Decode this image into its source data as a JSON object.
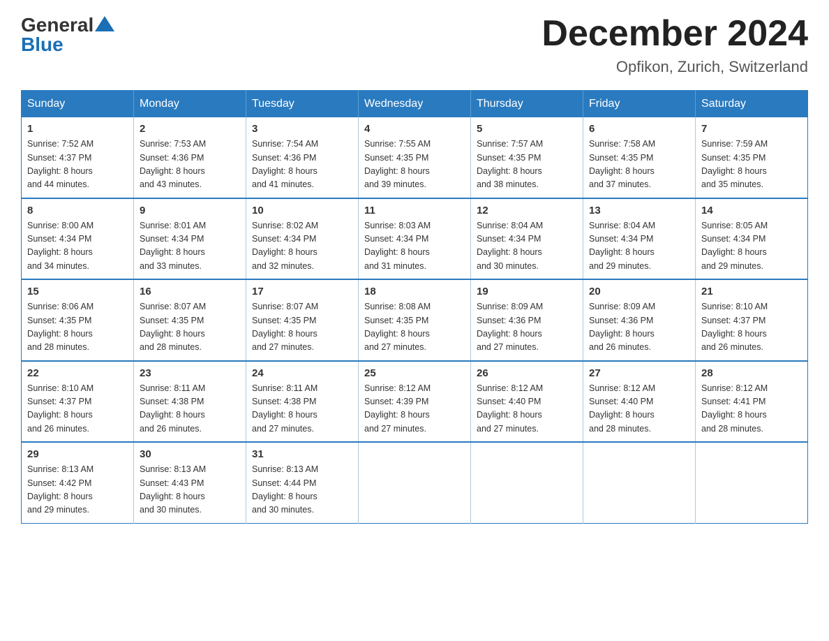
{
  "header": {
    "logo_general": "General",
    "logo_blue": "Blue",
    "main_title": "December 2024",
    "subtitle": "Opfikon, Zurich, Switzerland"
  },
  "calendar": {
    "days_of_week": [
      "Sunday",
      "Monday",
      "Tuesday",
      "Wednesday",
      "Thursday",
      "Friday",
      "Saturday"
    ],
    "weeks": [
      [
        {
          "day": "1",
          "sunrise": "7:52 AM",
          "sunset": "4:37 PM",
          "daylight": "8 hours and 44 minutes."
        },
        {
          "day": "2",
          "sunrise": "7:53 AM",
          "sunset": "4:36 PM",
          "daylight": "8 hours and 43 minutes."
        },
        {
          "day": "3",
          "sunrise": "7:54 AM",
          "sunset": "4:36 PM",
          "daylight": "8 hours and 41 minutes."
        },
        {
          "day": "4",
          "sunrise": "7:55 AM",
          "sunset": "4:35 PM",
          "daylight": "8 hours and 39 minutes."
        },
        {
          "day": "5",
          "sunrise": "7:57 AM",
          "sunset": "4:35 PM",
          "daylight": "8 hours and 38 minutes."
        },
        {
          "day": "6",
          "sunrise": "7:58 AM",
          "sunset": "4:35 PM",
          "daylight": "8 hours and 37 minutes."
        },
        {
          "day": "7",
          "sunrise": "7:59 AM",
          "sunset": "4:35 PM",
          "daylight": "8 hours and 35 minutes."
        }
      ],
      [
        {
          "day": "8",
          "sunrise": "8:00 AM",
          "sunset": "4:34 PM",
          "daylight": "8 hours and 34 minutes."
        },
        {
          "day": "9",
          "sunrise": "8:01 AM",
          "sunset": "4:34 PM",
          "daylight": "8 hours and 33 minutes."
        },
        {
          "day": "10",
          "sunrise": "8:02 AM",
          "sunset": "4:34 PM",
          "daylight": "8 hours and 32 minutes."
        },
        {
          "day": "11",
          "sunrise": "8:03 AM",
          "sunset": "4:34 PM",
          "daylight": "8 hours and 31 minutes."
        },
        {
          "day": "12",
          "sunrise": "8:04 AM",
          "sunset": "4:34 PM",
          "daylight": "8 hours and 30 minutes."
        },
        {
          "day": "13",
          "sunrise": "8:04 AM",
          "sunset": "4:34 PM",
          "daylight": "8 hours and 29 minutes."
        },
        {
          "day": "14",
          "sunrise": "8:05 AM",
          "sunset": "4:34 PM",
          "daylight": "8 hours and 29 minutes."
        }
      ],
      [
        {
          "day": "15",
          "sunrise": "8:06 AM",
          "sunset": "4:35 PM",
          "daylight": "8 hours and 28 minutes."
        },
        {
          "day": "16",
          "sunrise": "8:07 AM",
          "sunset": "4:35 PM",
          "daylight": "8 hours and 28 minutes."
        },
        {
          "day": "17",
          "sunrise": "8:07 AM",
          "sunset": "4:35 PM",
          "daylight": "8 hours and 27 minutes."
        },
        {
          "day": "18",
          "sunrise": "8:08 AM",
          "sunset": "4:35 PM",
          "daylight": "8 hours and 27 minutes."
        },
        {
          "day": "19",
          "sunrise": "8:09 AM",
          "sunset": "4:36 PM",
          "daylight": "8 hours and 27 minutes."
        },
        {
          "day": "20",
          "sunrise": "8:09 AM",
          "sunset": "4:36 PM",
          "daylight": "8 hours and 26 minutes."
        },
        {
          "day": "21",
          "sunrise": "8:10 AM",
          "sunset": "4:37 PM",
          "daylight": "8 hours and 26 minutes."
        }
      ],
      [
        {
          "day": "22",
          "sunrise": "8:10 AM",
          "sunset": "4:37 PM",
          "daylight": "8 hours and 26 minutes."
        },
        {
          "day": "23",
          "sunrise": "8:11 AM",
          "sunset": "4:38 PM",
          "daylight": "8 hours and 26 minutes."
        },
        {
          "day": "24",
          "sunrise": "8:11 AM",
          "sunset": "4:38 PM",
          "daylight": "8 hours and 27 minutes."
        },
        {
          "day": "25",
          "sunrise": "8:12 AM",
          "sunset": "4:39 PM",
          "daylight": "8 hours and 27 minutes."
        },
        {
          "day": "26",
          "sunrise": "8:12 AM",
          "sunset": "4:40 PM",
          "daylight": "8 hours and 27 minutes."
        },
        {
          "day": "27",
          "sunrise": "8:12 AM",
          "sunset": "4:40 PM",
          "daylight": "8 hours and 28 minutes."
        },
        {
          "day": "28",
          "sunrise": "8:12 AM",
          "sunset": "4:41 PM",
          "daylight": "8 hours and 28 minutes."
        }
      ],
      [
        {
          "day": "29",
          "sunrise": "8:13 AM",
          "sunset": "4:42 PM",
          "daylight": "8 hours and 29 minutes."
        },
        {
          "day": "30",
          "sunrise": "8:13 AM",
          "sunset": "4:43 PM",
          "daylight": "8 hours and 30 minutes."
        },
        {
          "day": "31",
          "sunrise": "8:13 AM",
          "sunset": "4:44 PM",
          "daylight": "8 hours and 30 minutes."
        },
        null,
        null,
        null,
        null
      ]
    ]
  }
}
